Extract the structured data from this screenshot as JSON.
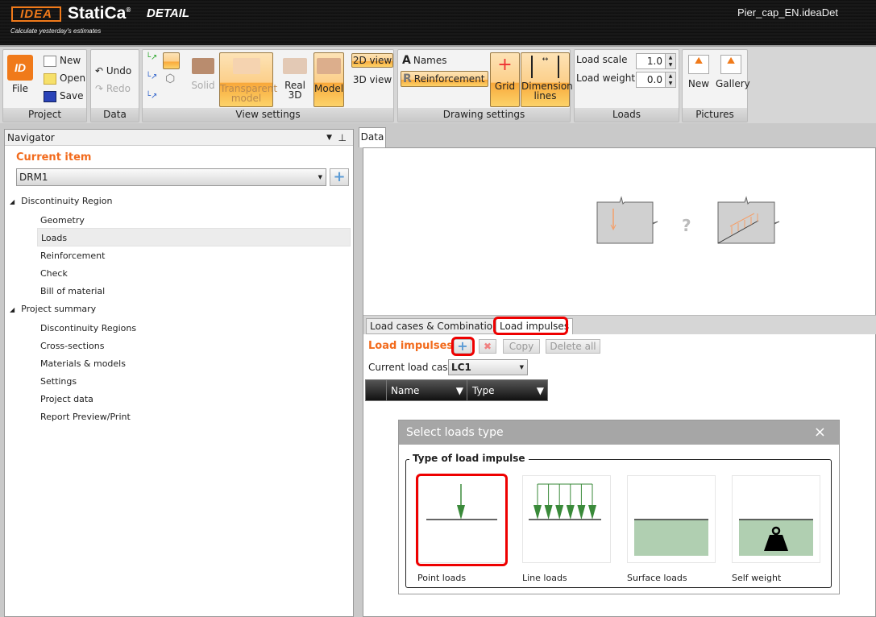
{
  "app": {
    "logo_idea": "IDEA",
    "logo_statica": "StatiCa",
    "logo_reg": "®",
    "logo_detail": "DETAIL",
    "slogan": "Calculate yesterday's estimates",
    "filename": "Pier_cap_EN.ideaDet"
  },
  "ribbon": {
    "project": {
      "label": "Project",
      "file": "File",
      "new": "New",
      "open": "Open",
      "save": "Save"
    },
    "data": {
      "label": "Data",
      "undo": "Undo",
      "redo": "Redo"
    },
    "view": {
      "label": "View settings",
      "solid": "Solid",
      "transparent": "Transparent model",
      "real3d": "Real 3D",
      "model": "Model",
      "view2d": "2D view",
      "view3d": "3D view"
    },
    "drawing": {
      "label": "Drawing settings",
      "names": "Names",
      "reinforcement": "Reinforcement",
      "grid": "Grid",
      "dimension": "Dimension lines"
    },
    "loads": {
      "label": "Loads",
      "scale_label": "Load scale",
      "scale_value": "1.0",
      "weight_label": "Load weight",
      "weight_value": "0.0"
    },
    "pictures": {
      "label": "Pictures",
      "new": "New",
      "gallery": "Gallery"
    }
  },
  "navigator": {
    "title": "Navigator",
    "current_item_label": "Current item",
    "current_item_value": "DRM1",
    "groups": [
      {
        "label": "Discontinuity Region",
        "items": [
          "Geometry",
          "Loads",
          "Reinforcement",
          "Check",
          "Bill of material"
        ]
      },
      {
        "label": "Project summary",
        "items": [
          "Discontinuity Regions",
          "Cross-sections",
          "Materials & models",
          "Settings",
          "Project data",
          "Report Preview/Print"
        ]
      }
    ],
    "selected": "Loads"
  },
  "main": {
    "tab": "Data",
    "preview_question": "?",
    "subtabs": [
      "Load cases & Combinations",
      "Load impulses"
    ],
    "section_title": "Load impulses",
    "copy": "Copy",
    "delete_all": "Delete all",
    "current_load_case_label": "Current load case",
    "current_load_case_value": "LC1",
    "columns": [
      "Name",
      "Type"
    ]
  },
  "dialog": {
    "title": "Select loads type",
    "close": "×",
    "group_title": "Type of load impulse",
    "options": [
      "Point loads",
      "Line loads",
      "Surface loads",
      "Self weight"
    ],
    "selected": "Point loads"
  },
  "colors": {
    "accent": "#f26b1d",
    "highlight": "#e00000",
    "load_green": "#3a8a3a",
    "surface_green": "#b0cfb1"
  }
}
